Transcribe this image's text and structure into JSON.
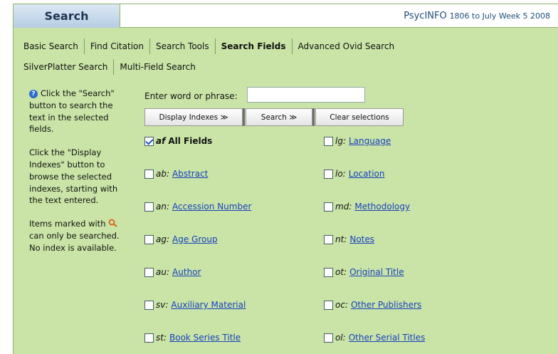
{
  "header": {
    "title": "Search",
    "database": "PsycINFO",
    "date_range": "1806 to July Week 5 2008"
  },
  "tabs": [
    {
      "label": "Basic Search",
      "active": false
    },
    {
      "label": "Find Citation",
      "active": false
    },
    {
      "label": "Search Tools",
      "active": false
    },
    {
      "label": "Search Fields",
      "active": true
    },
    {
      "label": "Advanced Ovid Search",
      "active": false
    },
    {
      "label": "SilverPlatter Search",
      "active": false
    },
    {
      "label": "Multi-Field Search",
      "active": false
    }
  ],
  "help": {
    "p1": "Click the \"Search\" button to search the text in the selected fields.",
    "p2": "Click the \"Display Indexes\" button to browse the selected indexes, starting with the text entered.",
    "p3_a": "Items marked with",
    "p3_b": "can only be searched. No index is available."
  },
  "search": {
    "label": "Enter word or phrase:",
    "value": "",
    "placeholder": ""
  },
  "buttons": {
    "display_indexes": "Display Indexes ≫",
    "search": "Search ≫",
    "clear": "Clear selections"
  },
  "fields_left": [
    {
      "code": "af",
      "name": "All Fields",
      "checked": true
    },
    {
      "code": "ab:",
      "name": "Abstract",
      "checked": false
    },
    {
      "code": "an:",
      "name": "Accession Number",
      "checked": false
    },
    {
      "code": "ag:",
      "name": "Age Group",
      "checked": false
    },
    {
      "code": "au:",
      "name": "Author",
      "checked": false
    },
    {
      "code": "sv:",
      "name": "Auxiliary Material",
      "checked": false
    },
    {
      "code": "st:",
      "name": "Book Series Title",
      "checked": false
    }
  ],
  "fields_right": [
    {
      "code": "lg:",
      "name": "Language",
      "checked": false
    },
    {
      "code": "lo:",
      "name": "Location",
      "checked": false
    },
    {
      "code": "md:",
      "name": "Methodology",
      "checked": false
    },
    {
      "code": "nt:",
      "name": "Notes",
      "checked": false
    },
    {
      "code": "ot:",
      "name": "Original Title",
      "checked": false
    },
    {
      "code": "oc:",
      "name": "Other Publishers",
      "checked": false
    },
    {
      "code": "ol:",
      "name": "Other Serial Titles",
      "checked": false
    }
  ],
  "colors": {
    "panel_bg": "#c9e4a6",
    "link": "#1840c0",
    "header_title_text": "#1d3552"
  }
}
